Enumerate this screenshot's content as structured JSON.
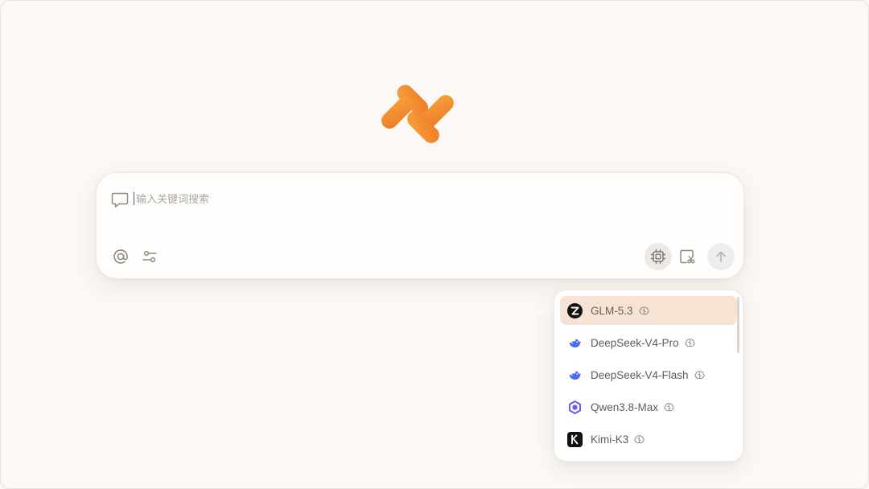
{
  "search": {
    "placeholder": "输入关键词搜索"
  },
  "toolbar": {
    "icons": [
      "chat-icon",
      "at-icon",
      "filter-icon",
      "model-chip-icon",
      "screenshot-icon",
      "send-arrow-icon"
    ]
  },
  "models": [
    {
      "name": "GLM-5.3",
      "icon": "zhipu-logo-icon",
      "selected": true
    },
    {
      "name": "DeepSeek-V4-Pro",
      "icon": "deepseek-logo-icon",
      "selected": false
    },
    {
      "name": "DeepSeek-V4-Flash",
      "icon": "deepseek-logo-icon",
      "selected": false
    },
    {
      "name": "Qwen3.8-Max",
      "icon": "qwen-logo-icon",
      "selected": false
    },
    {
      "name": "Kimi-K3",
      "icon": "kimi-logo-icon",
      "selected": false
    }
  ],
  "colors": {
    "background": "#fbf8f5",
    "brand_orange": "#f08a2e",
    "selected_row": "#f6e3d4"
  }
}
